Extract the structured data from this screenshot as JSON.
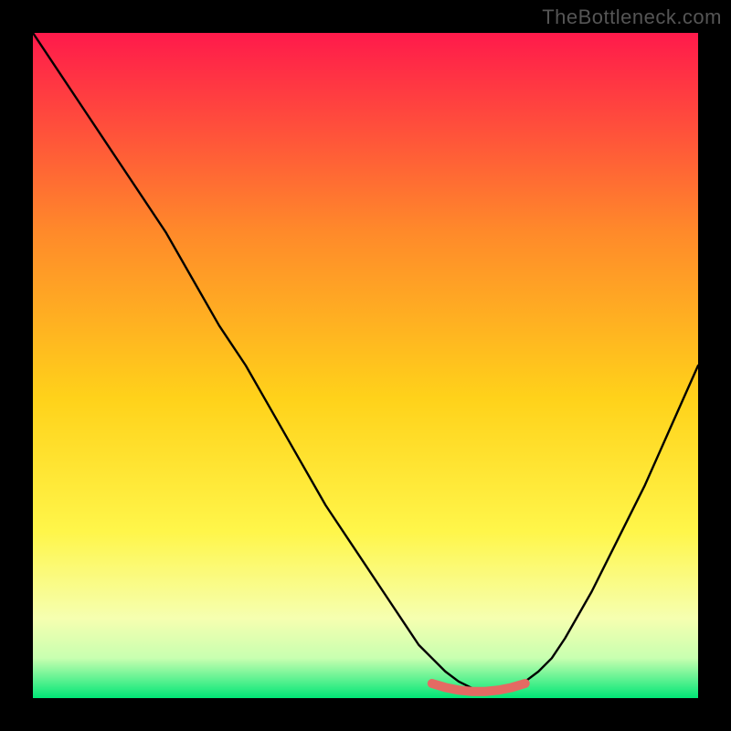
{
  "watermark": "TheBottleneck.com",
  "colors": {
    "frame_bg": "#000000",
    "grad_top": "#ff1a4b",
    "grad_mid1": "#ff8a2a",
    "grad_mid2": "#ffd21a",
    "grad_mid3": "#fff64a",
    "grad_mid4": "#eaff8a",
    "grad_bottom": "#00e676",
    "curve": "#000000",
    "marker": "#e46a63"
  },
  "chart_data": {
    "type": "line",
    "title": "",
    "xlabel": "",
    "ylabel": "",
    "xlim": [
      0,
      100
    ],
    "ylim": [
      0,
      100
    ],
    "series": [
      {
        "name": "bottleneck-curve",
        "x": [
          0,
          4,
          8,
          12,
          16,
          20,
          24,
          28,
          32,
          36,
          40,
          44,
          48,
          52,
          56,
          58,
          60,
          62,
          64,
          66,
          68,
          70,
          72,
          74,
          76,
          78,
          80,
          84,
          88,
          92,
          96,
          100
        ],
        "values": [
          100,
          94,
          88,
          82,
          76,
          70,
          63,
          56,
          50,
          43,
          36,
          29,
          23,
          17,
          11,
          8,
          6,
          4,
          2.5,
          1.5,
          1,
          1,
          1.5,
          2.5,
          4,
          6,
          9,
          16,
          24,
          32,
          41,
          50
        ]
      },
      {
        "name": "optimal-band",
        "x": [
          60,
          62,
          64,
          66,
          68,
          70,
          72,
          74
        ],
        "values": [
          2.2,
          1.6,
          1.2,
          1.0,
          1.0,
          1.2,
          1.6,
          2.2
        ]
      }
    ],
    "annotations": []
  }
}
